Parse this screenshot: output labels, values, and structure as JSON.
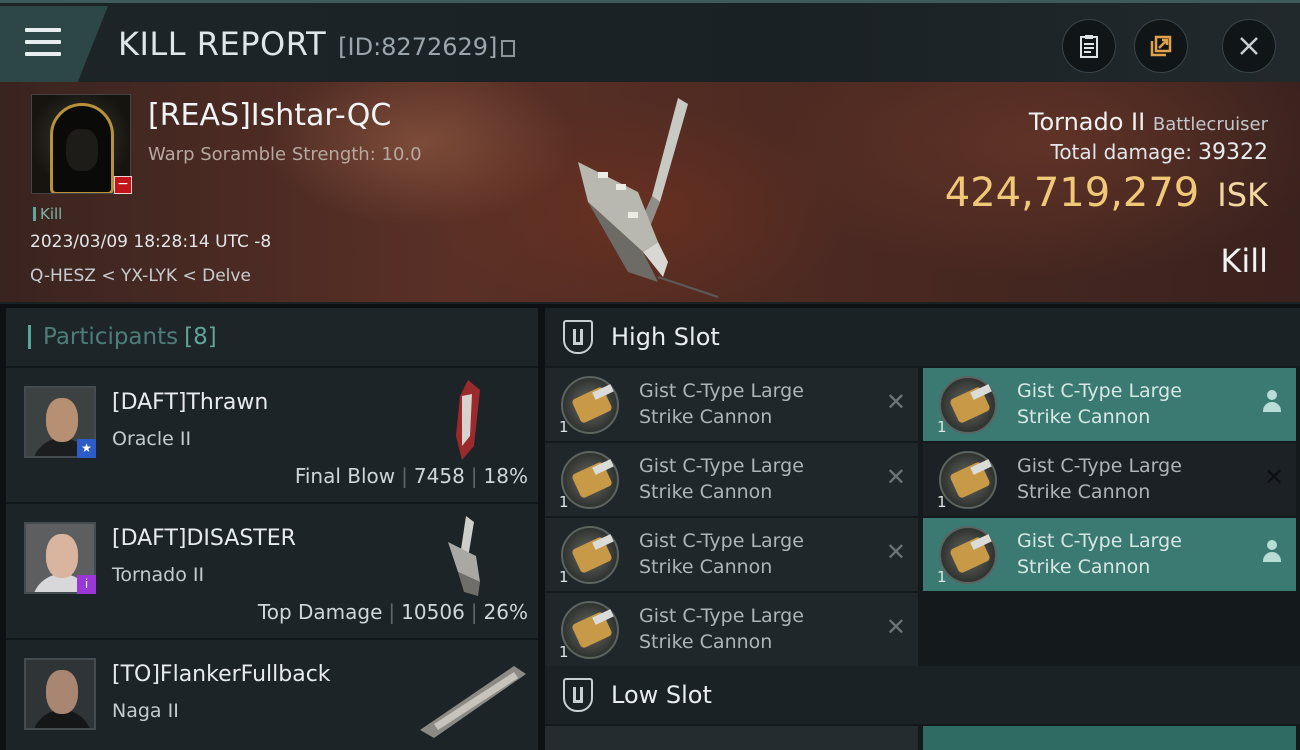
{
  "header": {
    "title": "KILL REPORT",
    "report_id": "[ID:8272629]"
  },
  "victim": {
    "name": "[REAS]Ishtar-QC",
    "scramble": "Warp Soramble Strength: 10.0",
    "tag": "Kill",
    "timestamp": "2023/03/09 18:28:14 UTC -8",
    "location": "Q-HESZ < YX-LYK < Delve",
    "ship": "Tornado II",
    "ship_class": "Battlecruiser",
    "damage_label": "Total damage:",
    "damage_value": "39322",
    "isk_value": "424,719,279",
    "isk_unit": "ISK",
    "result": "Kill"
  },
  "participants": {
    "label": "Participants",
    "count": "[8]",
    "items": [
      {
        "name": "[DAFT]Thrawn",
        "ship": "Oracle II",
        "role": "Final Blow",
        "damage": "7458",
        "percent": "18%"
      },
      {
        "name": "[DAFT]DISASTER",
        "ship": "Tornado II",
        "role": "Top Damage",
        "damage": "10506",
        "percent": "26%"
      },
      {
        "name": "[TO]FlankerFullback",
        "ship": "Naga II",
        "role": "",
        "damage": "",
        "percent": ""
      }
    ]
  },
  "high_slot": {
    "title": "High Slot",
    "modules": [
      {
        "name": "Gist C-Type Large Strike Cannon",
        "qty": "1"
      },
      {
        "name": "Gist C-Type Large Strike Cannon",
        "qty": "1"
      },
      {
        "name": "Gist C-Type Large Strike Cannon",
        "qty": "1"
      },
      {
        "name": "Gist C-Type Large Strike Cannon",
        "qty": "1"
      },
      {
        "name": "Gist C-Type Large Strike Cannon",
        "qty": "1"
      },
      {
        "name": "Gist C-Type Large Strike Cannon",
        "qty": "1"
      },
      {
        "name": "Gist C-Type Large Strike Cannon",
        "qty": "1"
      }
    ]
  },
  "low_slot": {
    "title": "Low Slot"
  },
  "colors": {
    "accent": "#5ea598",
    "isk": "#f0c978",
    "fitted": "#3a7a72",
    "badge_red": "#c2151b"
  }
}
